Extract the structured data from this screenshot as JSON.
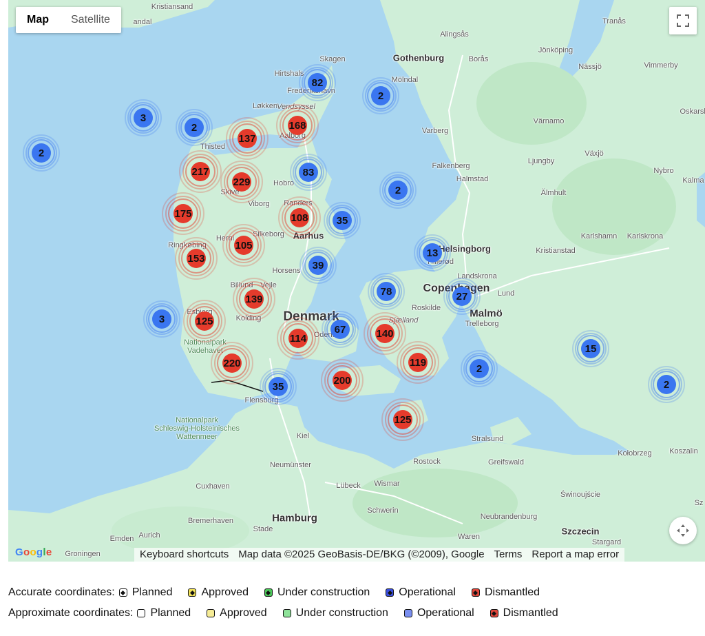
{
  "map_controls": {
    "map_label": "Map",
    "satellite_label": "Satellite",
    "active": "Map"
  },
  "places": {
    "kristiansand": "Kristiansand",
    "andal": "andal",
    "alingsas": "Alingsås",
    "trans": "Tranås",
    "skagen": "Skagen",
    "gothenburg": "Gothenburg",
    "boras": "Borås",
    "jonkoping": "Jönköping",
    "vimmerby": "Vimmerby",
    "hirtshals": "Hirtshals",
    "molndal": "Mölndal",
    "frederikshavn": "Frederikshavn",
    "nassjo": "Nässjö",
    "lokken": "Løkken",
    "vendsyssel": "Vendsyssel",
    "oskarsh": "Oskarsh",
    "varnamo": "Värnamo",
    "aalborg": "Aalborg",
    "varberg": "Varberg",
    "thisted": "Thisted",
    "vaxjo": "Växjö",
    "falkenberg": "Falkenberg",
    "ljungby": "Ljungby",
    "halmstad": "Halmstad",
    "nybro": "Nybro",
    "kalmar": "Kalma",
    "hobro": "Hobro",
    "skive": "Skive",
    "almhult": "Älmhult",
    "viborg": "Viborg",
    "randers": "Randers",
    "karlshamn": "Karlshamn",
    "karlskrona": "Karlskrona",
    "herning": "Herni",
    "silkeborg": "Silkeborg",
    "aarhus": "Aarhus",
    "ringkobing": "Ringkøbing",
    "helsingborg": "Helsingborg",
    "kristianstad": "Kristianstad",
    "hillerod": "Hillerød",
    "horsens": "Horsens",
    "landskrona": "Landskrona",
    "billund": "Billund",
    "vejle": "Vejle",
    "copenhagen": "Copenhagen",
    "lund": "Lund",
    "roskilde": "Roskilde",
    "esbjerg": "Esbjerg",
    "kolding": "Kolding",
    "denmark": "Denmark",
    "malmo": "Malmö",
    "sjaelland": "Sjælland",
    "trelleborg": "Trelleborg",
    "odense": "Odense",
    "nationalpark_vadehavet": "Nationalpark\nVadehavet",
    "flensburg": "Flensburg",
    "nationalpark_sh": "Nationalpark\nSchleswig-Holsteinisches\nWattenmeer",
    "kiel": "Kiel",
    "stralsund": "Stralsund",
    "neumunster": "Neumünster",
    "rostock": "Rostock",
    "greifswald": "Greifswald",
    "kolobrzeg": "Kołobrzeg",
    "koszalin": "Koszalin",
    "cuxhaven": "Cuxhaven",
    "lubeck": "Lübeck",
    "wismar": "Wismar",
    "swinoujscie": "Świnoujście",
    "schwerin": "Schwerin",
    "bremerhaven": "Bremerhaven",
    "hamburg": "Hamburg",
    "stade": "Stade",
    "neubrandenburg": "Neubrandenburg",
    "szczecin": "Szczecin",
    "stargard": "Stargard",
    "emden": "Emden",
    "aurich": "Aurich",
    "waren": "Waren",
    "groningen": "Groningen",
    "sz": "Sz"
  },
  "clusters": [
    {
      "count": "82",
      "status": "Operational"
    },
    {
      "count": "2",
      "status": "Operational"
    },
    {
      "count": "3",
      "status": "Operational"
    },
    {
      "count": "2",
      "status": "Operational"
    },
    {
      "count": "137",
      "status": "Dismantled"
    },
    {
      "count": "168",
      "status": "Dismantled"
    },
    {
      "count": "2",
      "status": "Operational"
    },
    {
      "count": "217",
      "status": "Dismantled"
    },
    {
      "count": "229",
      "status": "Dismantled"
    },
    {
      "count": "83",
      "status": "Operational"
    },
    {
      "count": "2",
      "status": "Operational"
    },
    {
      "count": "175",
      "status": "Dismantled"
    },
    {
      "count": "108",
      "status": "Dismantled"
    },
    {
      "count": "35",
      "status": "Operational"
    },
    {
      "count": "105",
      "status": "Dismantled"
    },
    {
      "count": "153",
      "status": "Dismantled"
    },
    {
      "count": "13",
      "status": "Operational"
    },
    {
      "count": "39",
      "status": "Operational"
    },
    {
      "count": "78",
      "status": "Operational"
    },
    {
      "count": "27",
      "status": "Operational"
    },
    {
      "count": "139",
      "status": "Dismantled"
    },
    {
      "count": "3",
      "status": "Operational"
    },
    {
      "count": "125",
      "status": "Dismantled"
    },
    {
      "count": "67",
      "status": "Operational"
    },
    {
      "count": "114",
      "status": "Dismantled"
    },
    {
      "count": "140",
      "status": "Dismantled"
    },
    {
      "count": "15",
      "status": "Operational"
    },
    {
      "count": "220",
      "status": "Dismantled"
    },
    {
      "count": "119",
      "status": "Dismantled"
    },
    {
      "count": "2",
      "status": "Operational"
    },
    {
      "count": "200",
      "status": "Dismantled"
    },
    {
      "count": "35",
      "status": "Operational"
    },
    {
      "count": "2",
      "status": "Operational"
    },
    {
      "count": "125",
      "status": "Dismantled"
    }
  ],
  "attribution": {
    "google": "Google",
    "keyboard": "Keyboard shortcuts",
    "mapdata": "Map data ©2025 GeoBasis-DE/BKG (©2009), Google",
    "terms": "Terms",
    "report": "Report a map error"
  },
  "legend": {
    "accurate_label": "Accurate coordinates:",
    "approximate_label": "Approximate coordinates:",
    "items": [
      {
        "label": "Planned",
        "accurate_color": "#ffffff",
        "approx_color": "#ffffff"
      },
      {
        "label": "Approved",
        "accurate_color": "#f2e35a",
        "approx_color": "#f6ec96"
      },
      {
        "label": "Under construction",
        "accurate_color": "#4cc75a",
        "approx_color": "#8fe39a"
      },
      {
        "label": "Operational",
        "accurate_color": "#3a4ee0",
        "approx_color": "#7a8ff0"
      },
      {
        "label": "Dismantled",
        "accurate_color": "#e0463a",
        "approx_color": "#e0463a"
      }
    ]
  },
  "colors": {
    "sea": "#a9d6f0",
    "land": "#cfeed8",
    "dismantled_cluster": "#e53b2c",
    "operational_cluster": "#3a76f0"
  }
}
